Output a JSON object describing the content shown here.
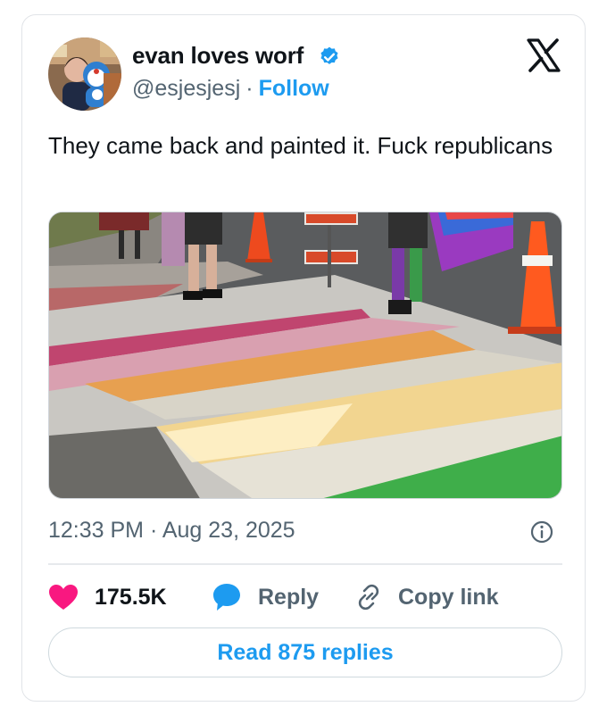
{
  "tweet": {
    "author": {
      "name": "evan loves worf",
      "handle": "@esjesjesj",
      "separator": "·",
      "follow_label": "Follow",
      "verified": true
    },
    "text": "They came back and painted it. Fuck republicans",
    "media": {
      "alt": "Rainbow crosswalk repainted on a street"
    },
    "timestamp": "12:33 PM · Aug 23, 2025",
    "actions": {
      "likes": "175.5K",
      "reply_label": "Reply",
      "copy_label": "Copy link"
    },
    "read_replies_label": "Read 875 replies"
  },
  "icons": {
    "logo": "x-logo-icon",
    "verified": "verified-badge-icon",
    "info": "info-icon",
    "like": "heart-icon",
    "reply": "speech-bubble-icon",
    "copy": "link-icon"
  },
  "colors": {
    "accent": "#1d9bf0",
    "like": "#f91880",
    "text": "#0f1419",
    "muted": "#536471",
    "border": "#cfd9de"
  }
}
